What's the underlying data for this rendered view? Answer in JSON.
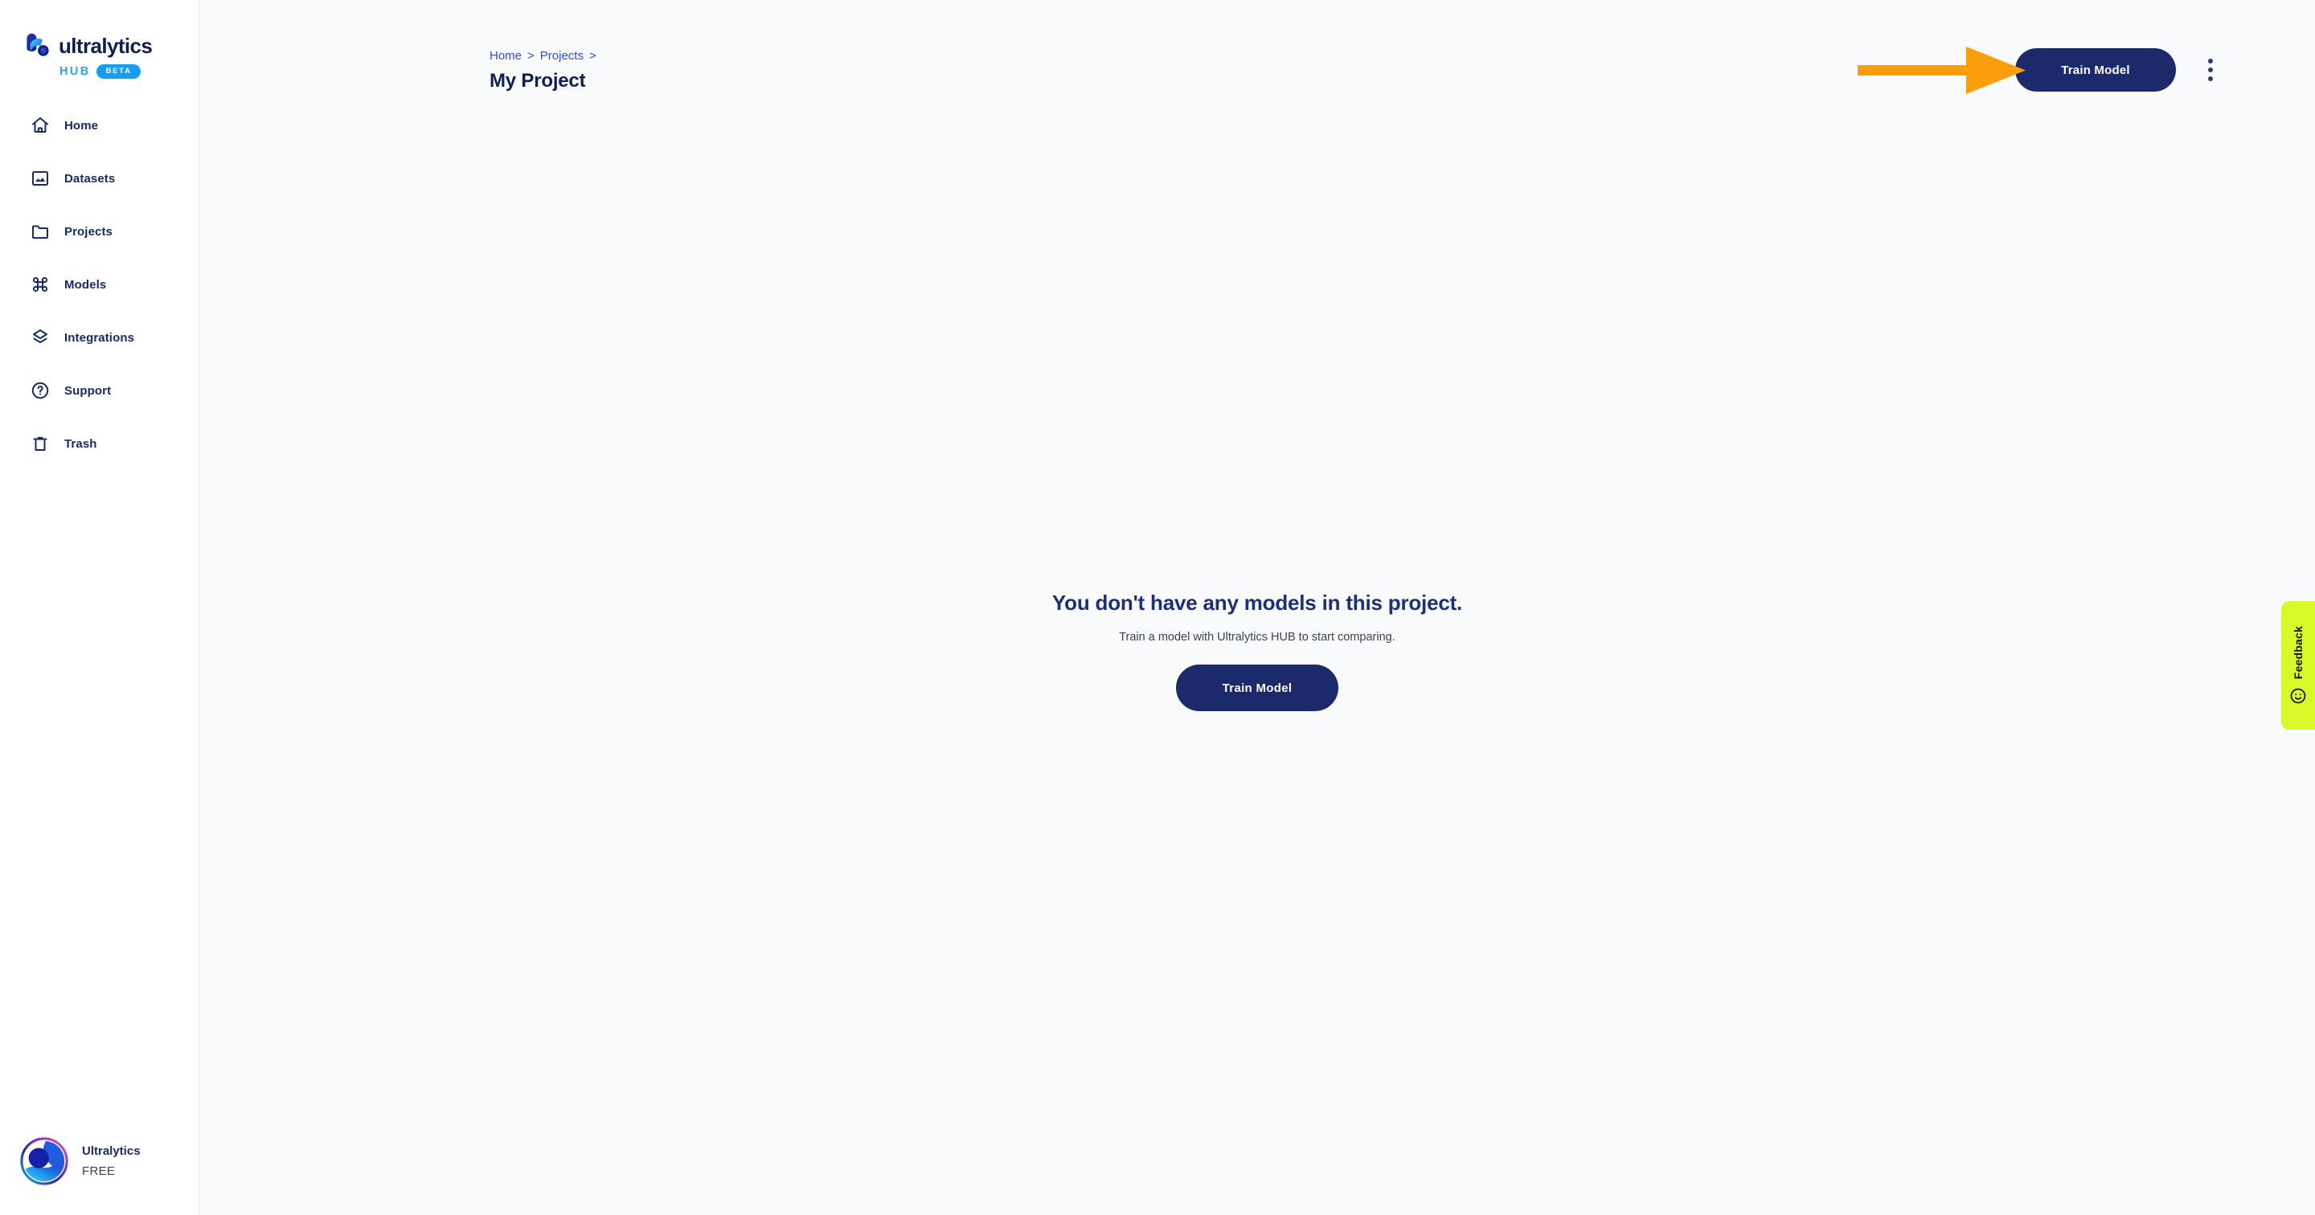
{
  "brand": {
    "word": "ultralytics",
    "hub": "HUB",
    "beta": "BETA",
    "logo_icon": "ultralytics-logo-icon"
  },
  "sidebar": {
    "items": [
      {
        "label": "Home",
        "icon": "home-icon"
      },
      {
        "label": "Datasets",
        "icon": "image-icon"
      },
      {
        "label": "Projects",
        "icon": "folder-icon"
      },
      {
        "label": "Models",
        "icon": "command-icon"
      },
      {
        "label": "Integrations",
        "icon": "layers-icon"
      },
      {
        "label": "Support",
        "icon": "question-circle-icon"
      },
      {
        "label": "Trash",
        "icon": "trash-icon"
      }
    ],
    "account": {
      "name": "Ultralytics",
      "plan": "FREE",
      "avatar_icon": "user-avatar"
    }
  },
  "header": {
    "breadcrumb": [
      {
        "label": "Home",
        "sep": ">"
      },
      {
        "label": "Projects",
        "sep": ">"
      }
    ],
    "title": "My Project",
    "train_button": "Train Model",
    "menu_icon": "kebab-menu-icon"
  },
  "empty_state": {
    "title": "You don't have any models in this project.",
    "subtitle": "Train a model with Ultralytics HUB to start comparing.",
    "button": "Train Model"
  },
  "feedback": {
    "label": "Feedback",
    "icon": "smiley-face-icon"
  },
  "annotation": {
    "type": "arrow",
    "points_to": "Train Model",
    "color": "#FB9E0E"
  },
  "colors": {
    "sidebar_bg": "#ffffff",
    "main_bg": "#f9fafc",
    "primary_navy": "#1c2a6b",
    "text_navy": "#1a2a66",
    "link_blue": "#2f4bd8",
    "hub_blue": "#2aa3f0",
    "beta_blue": "#169ef5",
    "feedback_green": "#d8f828",
    "arrow_orange": "#FB9E0E"
  }
}
